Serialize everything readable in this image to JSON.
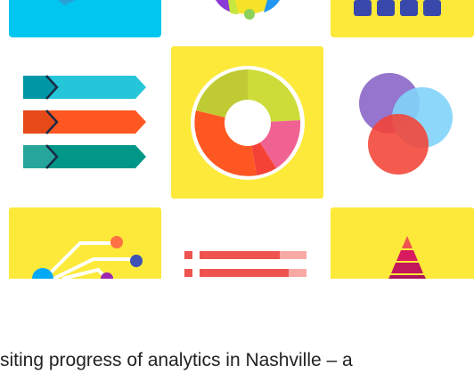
{
  "colors": {
    "yellow": "#fde93a",
    "cyan": "#00c6f0",
    "white": "#ffffff",
    "text": "#222222"
  },
  "icons": [
    "top-left-cyan-tile-icon",
    "half-pie-icon",
    "blue-squares-icon",
    "chevron-bars-icon",
    "donut-chart-icon",
    "venn-diagram-icon",
    "circuit-lines-icon",
    "horizontal-bars-icon",
    "pyramid-icon"
  ],
  "article": {
    "line1": "siting progress of analytics in Nashville – a"
  }
}
